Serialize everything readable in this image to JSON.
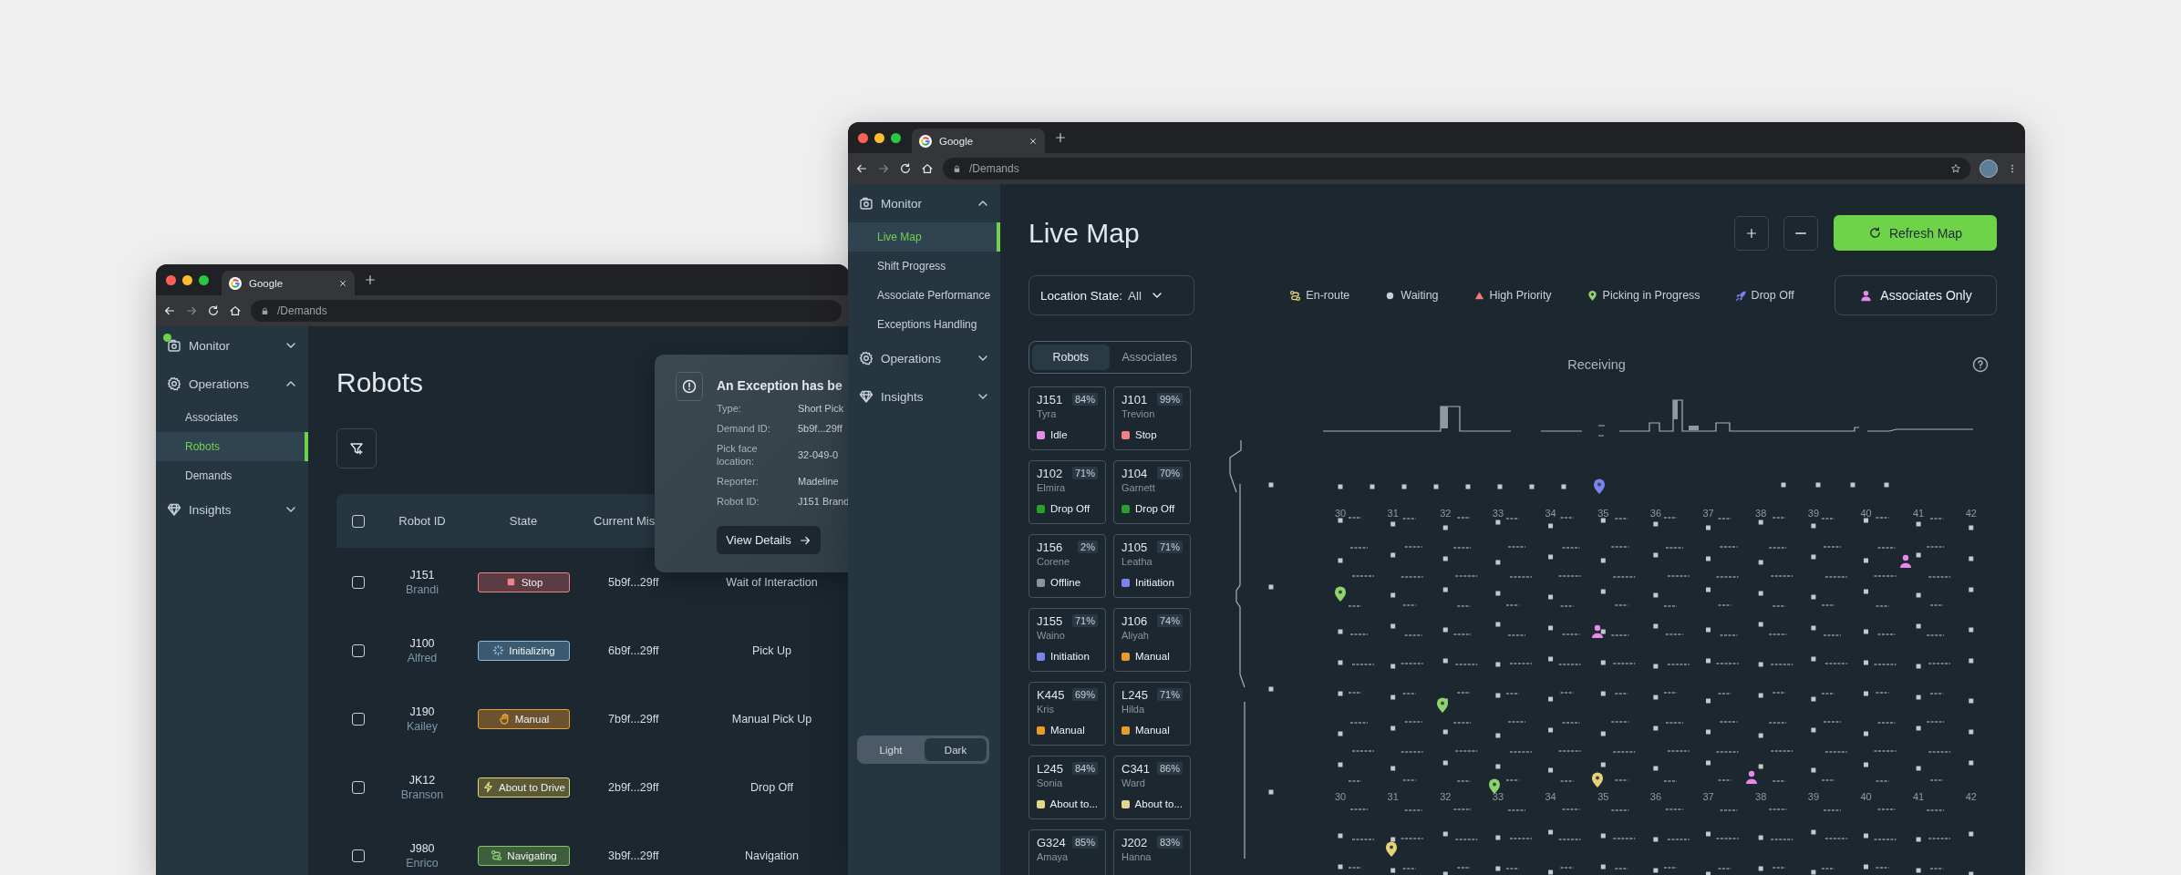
{
  "back_window": {
    "browser": {
      "tab_title": "Google",
      "address": "/Demands"
    },
    "sidebar": [
      {
        "label": "Monitor",
        "kind": "monitor",
        "expanded": false,
        "notification": true
      },
      {
        "label": "Operations",
        "kind": "operations",
        "expanded": true,
        "notification": false,
        "items": [
          {
            "label": "Associates",
            "selected": false
          },
          {
            "label": "Robots",
            "selected": true
          },
          {
            "label": "Demands",
            "selected": false
          }
        ]
      },
      {
        "label": "Insights",
        "kind": "insights",
        "expanded": false,
        "notification": false
      }
    ],
    "page_title": "Robots",
    "table": {
      "select_all_checked": false,
      "columns": [
        "Robot ID",
        "State",
        "Current Mis"
      ],
      "rows": [
        {
          "checked": false,
          "robot_id": "J151",
          "name": "Brandi",
          "state": {
            "label": "Stop",
            "kind": "stop"
          },
          "mission": "5b9f...29ff",
          "column_5": "Wait of Interaction"
        },
        {
          "checked": false,
          "robot_id": "J100",
          "name": "Alfred",
          "state": {
            "label": "Initializing",
            "kind": "initializing"
          },
          "mission": "6b9f...29ff",
          "column_5": "Pick Up"
        },
        {
          "checked": false,
          "robot_id": "J190",
          "name": "Kailey",
          "state": {
            "label": "Manual",
            "kind": "manual"
          },
          "mission": "7b9f...29ff",
          "column_5": "Manual Pick Up"
        },
        {
          "checked": false,
          "robot_id": "JK12",
          "name": "Branson",
          "state": {
            "label": "About to Drive",
            "kind": "about_to_drive"
          },
          "mission": "2b9f...29ff",
          "column_5": "Drop Off"
        },
        {
          "checked": false,
          "robot_id": "J980",
          "name": "Enrico",
          "state": {
            "label": "Navigating",
            "kind": "navigating"
          },
          "mission": "3b9f...29ff",
          "column_5": "Navigation"
        }
      ]
    },
    "exception_popup": {
      "title": "An Exception has be",
      "fields": [
        {
          "label": "Type:",
          "value": "Short Pick"
        },
        {
          "label": "Demand ID:",
          "value": "5b9f...29ff"
        },
        {
          "label": "Pick face location:",
          "value": "32-049-0"
        },
        {
          "label": "Reporter:",
          "value": "Madeline"
        },
        {
          "label": "Robot ID:",
          "value": "J151 Brand"
        }
      ],
      "button": "View Details"
    }
  },
  "front_window": {
    "browser": {
      "tab_title": "Google",
      "address": "/Demands"
    },
    "sidebar": [
      {
        "label": "Monitor",
        "kind": "monitor",
        "expanded": true,
        "notification": false,
        "items": [
          {
            "label": "Live Map",
            "selected": true
          },
          {
            "label": "Shift Progress",
            "selected": false
          },
          {
            "label": "Associate Performance",
            "selected": false
          },
          {
            "label": "Exceptions Handling",
            "selected": false
          }
        ]
      },
      {
        "label": "Operations",
        "kind": "operations",
        "expanded": false,
        "notification": false
      },
      {
        "label": "Insights",
        "kind": "insights",
        "expanded": false,
        "notification": false
      }
    ],
    "theme_toggle": [
      {
        "label": "Light",
        "selected": false
      },
      {
        "label": "Dark",
        "selected": true
      }
    ],
    "page_title": "Live Map",
    "refresh_button": "Refresh Map",
    "location_filter": {
      "label": "Location State:",
      "value": "All"
    },
    "legend": [
      {
        "label": "En-route",
        "kind": "en_route"
      },
      {
        "label": "Waiting",
        "kind": "waiting"
      },
      {
        "label": "High Priority",
        "kind": "high_priority"
      },
      {
        "label": "Picking in Progress",
        "kind": "picking"
      },
      {
        "label": "Drop Off",
        "kind": "drop_off"
      }
    ],
    "associates_button": "Associates Only",
    "view_tabs": [
      {
        "label": "Robots",
        "selected": true
      },
      {
        "label": "Associates",
        "selected": false
      }
    ],
    "robot_cards": [
      {
        "id": "J151",
        "name": "Tyra",
        "battery": "84%",
        "state": "Idle",
        "color": "#e48ce8"
      },
      {
        "id": "J101",
        "name": "Trevion",
        "battery": "99%",
        "state": "Stop",
        "color": "#f08282"
      },
      {
        "id": "J102",
        "name": "Elmira",
        "battery": "71%",
        "state": "Drop Off",
        "color": "#2ca02c"
      },
      {
        "id": "J104",
        "name": "Garnett",
        "battery": "70%",
        "state": "Drop Off",
        "color": "#2ca02c"
      },
      {
        "id": "J156",
        "name": "Corene",
        "battery": "2%",
        "state": "Offline",
        "color": "#8a969e"
      },
      {
        "id": "J105",
        "name": "Leatha",
        "battery": "71%",
        "state": "Initiation",
        "color": "#7b83ef"
      },
      {
        "id": "J155",
        "name": "Waino",
        "battery": "71%",
        "state": "Initiation",
        "color": "#7b83ef"
      },
      {
        "id": "J106",
        "name": "Aliyah",
        "battery": "74%",
        "state": "Manual",
        "color": "#e89b26"
      },
      {
        "id": "K445",
        "name": "Kris",
        "battery": "69%",
        "state": "Manual",
        "color": "#e89b26"
      },
      {
        "id": "L245",
        "name": "Hilda",
        "battery": "71%",
        "state": "Manual",
        "color": "#e89b26"
      },
      {
        "id": "L245",
        "name": "Sonia",
        "battery": "84%",
        "state": "About to...",
        "color": "#e2d88c"
      },
      {
        "id": "C341",
        "name": "Ward",
        "battery": "86%",
        "state": "About to...",
        "color": "#e2d88c"
      },
      {
        "id": "G324",
        "name": "Amaya",
        "battery": "85%"
      },
      {
        "id": "J202",
        "name": "Hanna",
        "battery": "83%"
      }
    ],
    "map": {
      "title": "Receiving",
      "aisle_label_rows": [
        {
          "labels": [
            "30",
            "31",
            "32",
            "33",
            "34",
            "35",
            "36",
            "37",
            "38",
            "39",
            "40",
            "41",
            "42"
          ]
        },
        {
          "labels": [
            "30",
            "31",
            "32",
            "33",
            "34",
            "35",
            "36",
            "37",
            "38",
            "39",
            "40",
            "41",
            "42"
          ]
        }
      ],
      "markers": [
        {
          "kind": "drop_off"
        },
        {
          "kind": "picking"
        },
        {
          "kind": "associate"
        },
        {
          "kind": "associate"
        },
        {
          "kind": "picking"
        },
        {
          "kind": "picking"
        },
        {
          "kind": "en_route"
        },
        {
          "kind": "associate"
        },
        {
          "kind": "en_route"
        }
      ]
    }
  }
}
